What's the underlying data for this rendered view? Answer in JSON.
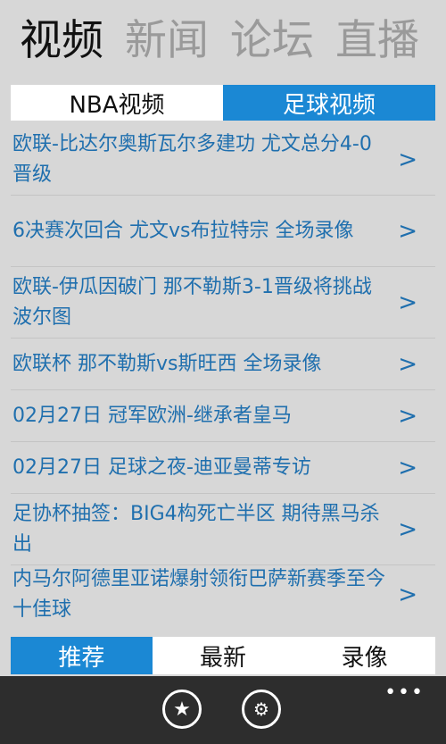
{
  "pivot": {
    "items": [
      {
        "label": "视频"
      },
      {
        "label": "新闻"
      },
      {
        "label": "论坛"
      },
      {
        "label": "直播"
      }
    ]
  },
  "tabs": [
    {
      "label": "NBA视频"
    },
    {
      "label": "足球视频"
    }
  ],
  "list": {
    "arrow_glyph": ">",
    "items": [
      {
        "title": "欧联-比达尔奥斯瓦尔多建功 尤文总分4-0晋级"
      },
      {
        "title": "6决赛次回合 尤文vs布拉特宗 全场录像"
      },
      {
        "title": "欧联-伊瓜因破门 那不勒斯3-1晋级将挑战波尔图"
      },
      {
        "title": "欧联杯 那不勒斯vs斯旺西 全场录像"
      },
      {
        "title": "02月27日 冠军欧洲-继承者皇马"
      },
      {
        "title": "02月27日 足球之夜-迪亚曼蒂专访"
      },
      {
        "title": "足协杯抽签：BIG4构死亡半区 期待黑马杀出"
      },
      {
        "title": "内马尔阿德里亚诺爆射领衔巴萨新赛季至今十佳球"
      }
    ]
  },
  "bottom_tabs": [
    {
      "label": "推荐"
    },
    {
      "label": "最新"
    },
    {
      "label": "录像"
    }
  ],
  "appbar": {
    "star_glyph": "★",
    "gear_glyph": "⚙",
    "more_glyph": "•••"
  },
  "colors": {
    "accent": "#1b88d4",
    "link": "#1f6fae",
    "background": "#d7d7d7",
    "appbar": "#2d2d2d"
  }
}
